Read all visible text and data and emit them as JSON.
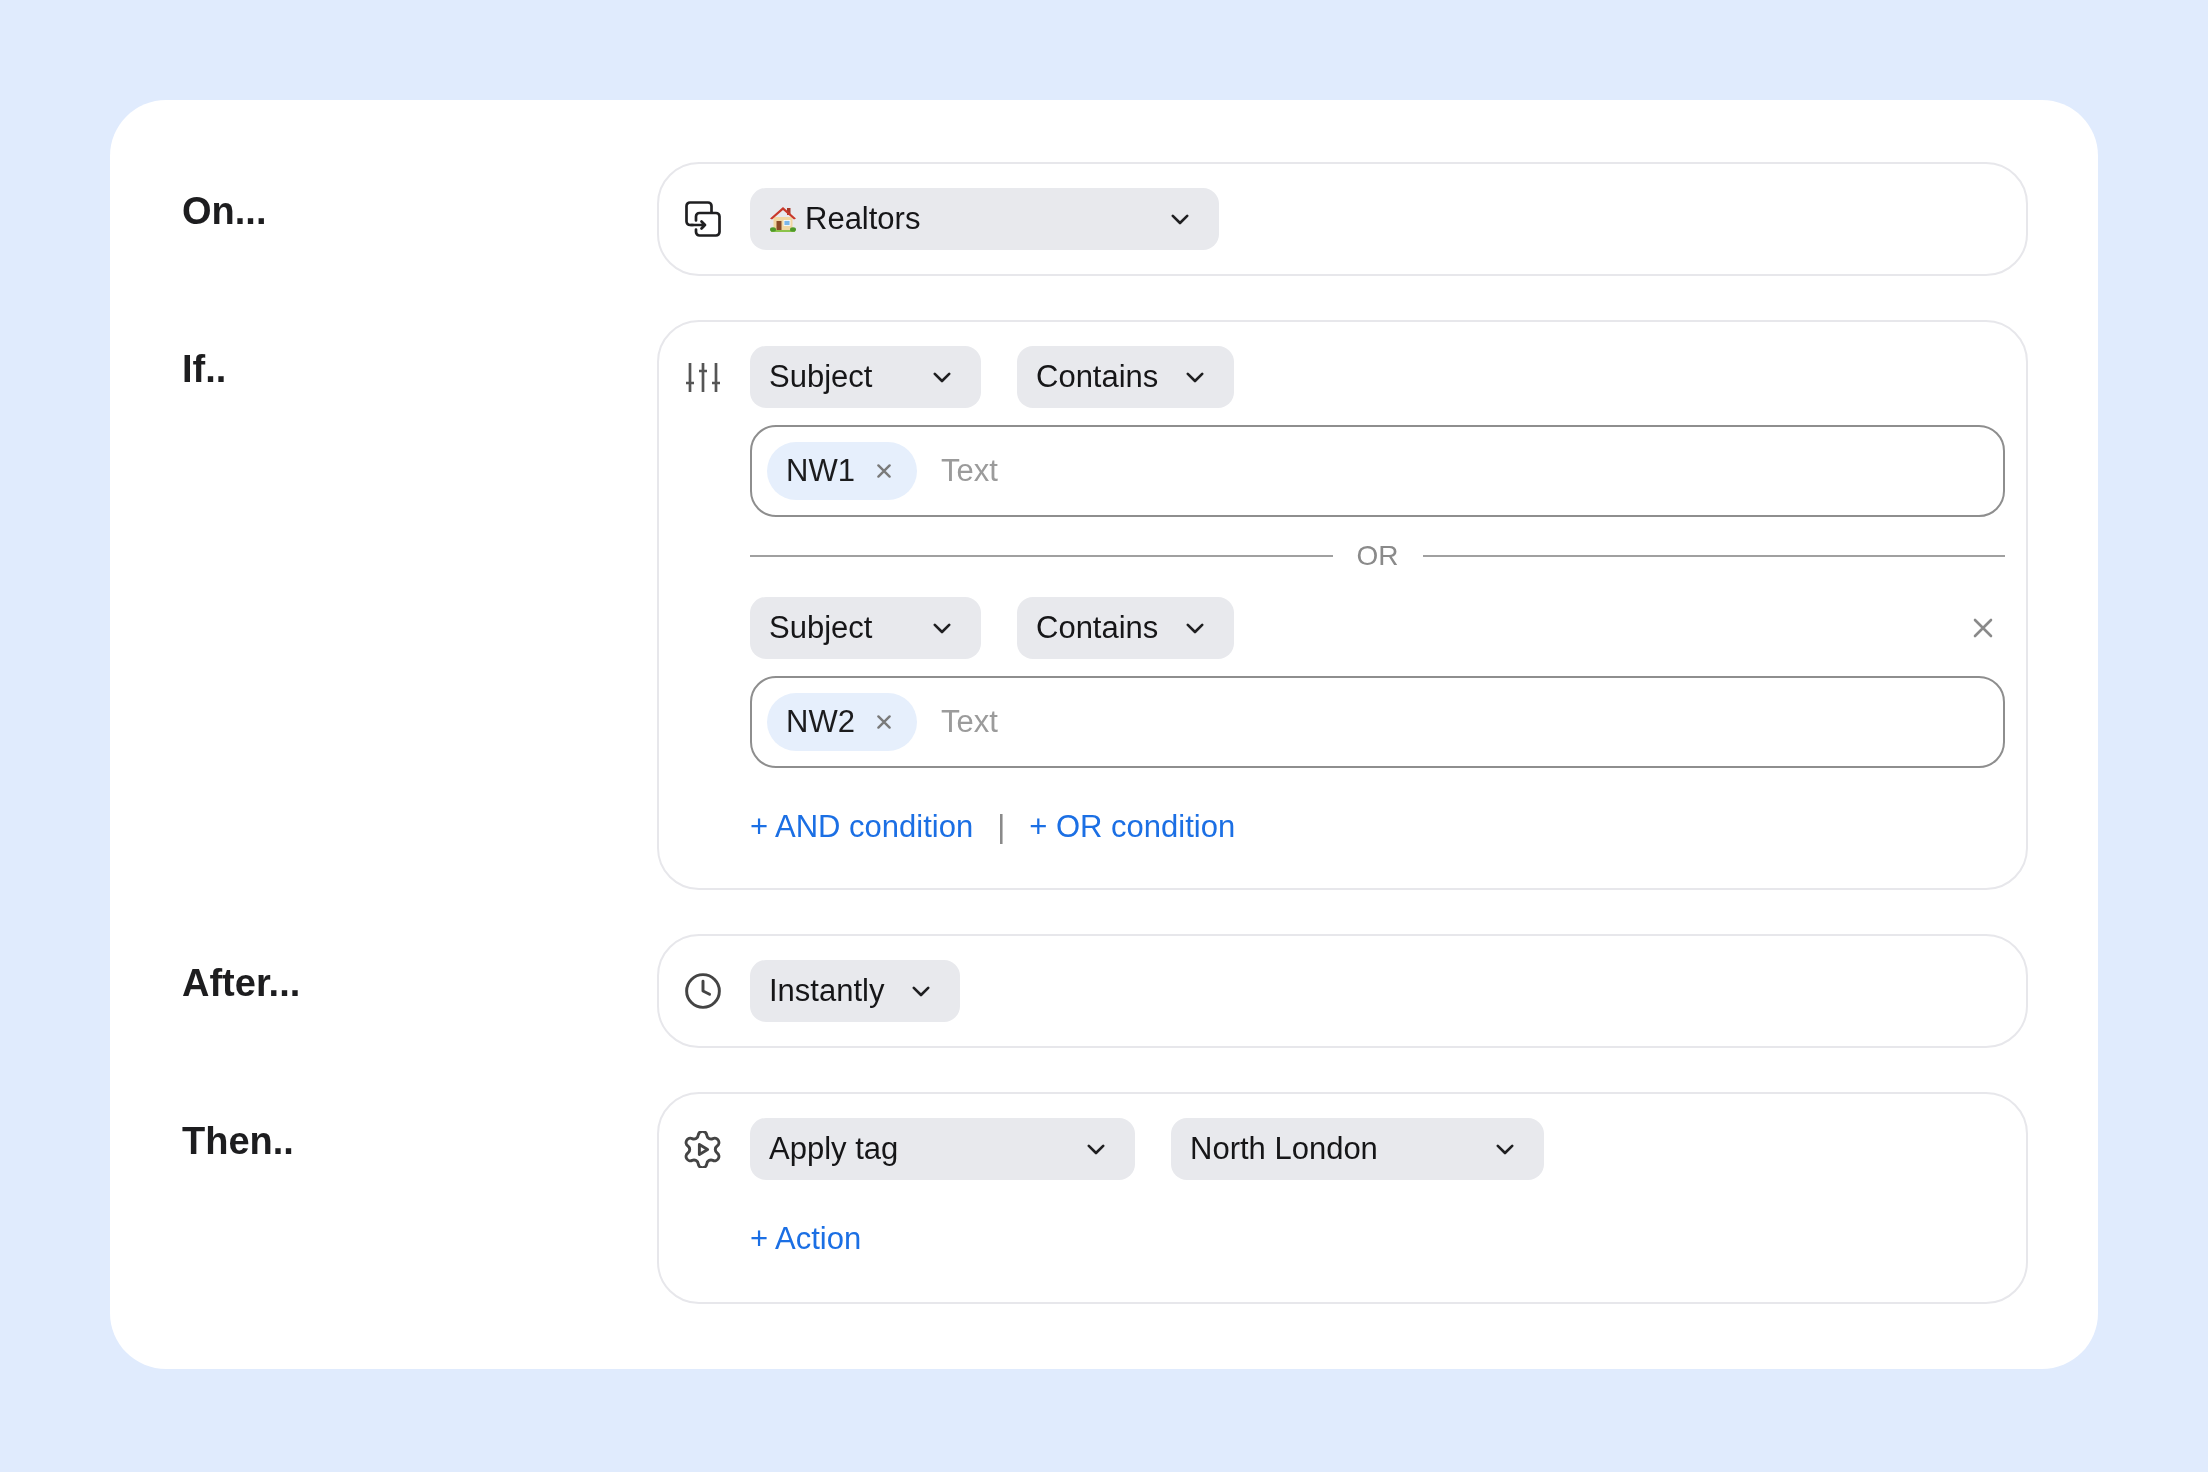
{
  "sections": [
    {
      "kind": "trigger",
      "label": "On...",
      "selects": [
        {
          "value": "Realtors"
        }
      ]
    },
    {
      "kind": "conditions",
      "label": "If..",
      "groups": [
        {
          "selects": [
            {
              "value": "Subject"
            },
            {
              "value": "Contains"
            }
          ],
          "tags": [
            {
              "label": "NW1"
            }
          ],
          "placeholder": "Text",
          "removable": false
        },
        {
          "separator": "OR",
          "selects": [
            {
              "value": "Subject"
            },
            {
              "value": "Contains"
            }
          ],
          "tags": [
            {
              "label": "NW2"
            }
          ],
          "placeholder": "Text",
          "removable": true
        }
      ],
      "links": [
        "+ AND condition",
        "+ OR condition"
      ],
      "divider": "|"
    },
    {
      "kind": "delay",
      "label": "After...",
      "selects": [
        {
          "value": "Instantly"
        }
      ]
    },
    {
      "kind": "actions",
      "label": "Then..",
      "selects": [
        {
          "value": "Apply tag"
        },
        {
          "value": "North London"
        }
      ],
      "links": [
        "+ Action"
      ]
    }
  ]
}
